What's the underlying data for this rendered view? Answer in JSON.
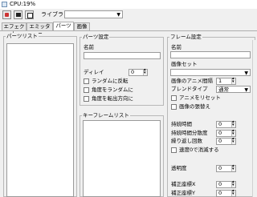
{
  "window": {
    "title": "CPU:19%"
  },
  "toolbar": {
    "library_label": "ライブラリ",
    "library_value": ""
  },
  "tabs": [
    {
      "label": "エフェクト"
    },
    {
      "label": "エミッター"
    },
    {
      "label": "パーツ"
    },
    {
      "label": "画像"
    }
  ],
  "parts_list": {
    "title": "パーツリスト"
  },
  "parts_settings": {
    "title": "パーツ設定",
    "name_label": "名前",
    "name_value": "",
    "delay_label": "ディレイ",
    "delay_value": "0",
    "checkboxes": [
      {
        "label": "ランダムに反転"
      },
      {
        "label": "角度をランダムに"
      },
      {
        "label": "角度を転出方向に"
      }
    ]
  },
  "keyframe_list": {
    "title": "キーフレームリスト"
  },
  "frame_settings": {
    "title": "フレーム設定",
    "name_label": "名前",
    "name_value": "",
    "imageset_label": "画像セット",
    "imageset_value": "",
    "anim_interval_label": "画像のアニメ間隔",
    "anim_interval_value": "1",
    "blend_label": "ブレンドタイプ",
    "blend_value": "通常",
    "anim_reset_label": "アニメをリセット",
    "image_tile_label": "画像の張替え",
    "duration_label": "持続時間",
    "duration_value": "0",
    "duration_var_label": "持続時間分散度",
    "duration_var_value": "0",
    "repeat_label": "繰り返し回数",
    "repeat_value": "0",
    "speed_zero_label": "速度0で消滅する",
    "opacity_label": "透明度",
    "opacity_value": "0",
    "coord_x_label": "補正座標X",
    "coord_x_value": "0",
    "coord_y_label": "補正座標Y",
    "coord_y_value": "0"
  }
}
